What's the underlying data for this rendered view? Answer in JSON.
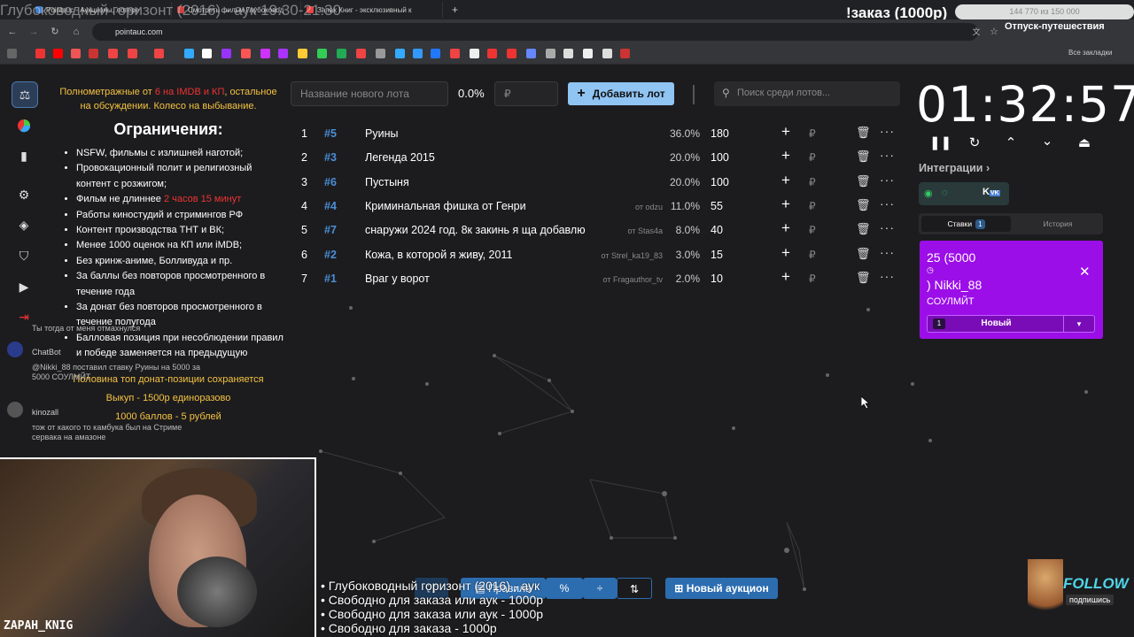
{
  "browser": {
    "tabs": [
      {
        "label": "Pointauc - Аукционы, лотере",
        "color": "#3b7fd6"
      },
      {
        "label": "Смотреть фильм Глубоковод",
        "color": "#c44"
      },
      {
        "label": "Запах Книг - эксклюзивный к",
        "color": "#e44"
      }
    ],
    "url": "pointauc.com",
    "all_bookmarks": "Все закладки"
  },
  "overlay": {
    "stream_title": "Глубоководный горизонт (2016) - аук 19:30-21:30",
    "zakaz": "!заказ (1000р)",
    "counter": "144 770 из 150 000",
    "otpusk": "Отпуск-путешествия",
    "follow": "FOLLOW",
    "podpishis": "подпишись",
    "camname": "ZAPAH_KNIG",
    "bottom_list": [
      "• Глубоководный горизонт (2016) - аук",
      "• Свободно для заказа или аук - 1000р",
      "• Свободно для заказа или аук - 1000р",
      "• Свободно для заказа - 1000р"
    ]
  },
  "rules": {
    "intro_a": "Полнометражные от ",
    "intro_red": "6 на IMDB и КП",
    "intro_b": ", остальное на обсуждении. Колесо на выбывание.",
    "heading": "Ограничения:",
    "items": [
      "NSFW, фильмы с излишней наготой;",
      "Провокационный полит и религиозный контент с розжигом;",
      "Работы киностудий и стримингов РФ",
      "Контент производства ТНТ и ВК;",
      "Менее 1000 оценок на КП или iMDB;",
      "Без кринж-аниме, Болливуда и пр.",
      "За баллы без повторов просмотренного в течение года",
      "За донат без повторов просмотренного в течение полугода",
      "Балловая позиция при несоблюдении правил и победе заменяется на предыдущую"
    ],
    "film_limit_a": "Фильм не длиннее ",
    "film_limit_red": "2 часов 15 минут",
    "footer": [
      "Половина топ донат-позиции сохраняется",
      "Выкуп - 1500р единоразово",
      "1000 баллов - 5 рублей"
    ]
  },
  "chat": [
    {
      "text": "Ты тогда от меня отмахнулся"
    },
    {
      "user": "ChatBot",
      "text": "@Nikki_88 поставил ставку Руины на 5000 за 5000 СОУЛМЙТ"
    },
    {
      "user": "kinozall",
      "text": "тож от какого то камбука был на Стриме сервака на амазоне"
    }
  ],
  "auction": {
    "lot_placeholder": "Название нового лота",
    "total_pct": "0.0%",
    "rub_placeholder": "₽",
    "add_button": "Добавить лот",
    "search_placeholder": "Поиск среди лотов...",
    "rub": "₽",
    "lots": [
      {
        "n": "1",
        "rank": "#5",
        "name": "Руины",
        "from": "",
        "pct": "36.0%",
        "amount": "180"
      },
      {
        "n": "2",
        "rank": "#3",
        "name": "Легенда 2015",
        "from": "",
        "pct": "20.0%",
        "amount": "100"
      },
      {
        "n": "3",
        "rank": "#6",
        "name": "Пустыня",
        "from": "",
        "pct": "20.0%",
        "amount": "100"
      },
      {
        "n": "4",
        "rank": "#4",
        "name": "Криминальная фишка от Генри",
        "from": "от odzu",
        "pct": "11.0%",
        "amount": "55"
      },
      {
        "n": "5",
        "rank": "#7",
        "name": "снаружи 2024 год. 8к закинь я ща добавлю",
        "from": "от Stas4a",
        "pct": "8.0%",
        "amount": "40"
      },
      {
        "n": "6",
        "rank": "#2",
        "name": "Кожа, в которой я живу, 2011",
        "from": "от Strel_ka19_83",
        "pct": "3.0%",
        "amount": "15"
      },
      {
        "n": "7",
        "rank": "#1",
        "name": "Враг у ворот",
        "from": "от Fragauthor_tv",
        "pct": "2.0%",
        "amount": "10"
      }
    ]
  },
  "timer": {
    "value": "01:32:57"
  },
  "integrations": {
    "label": "Интеграции"
  },
  "bids": {
    "tab_bids": "Ставки",
    "tab_bids_count": "1",
    "tab_history": "История",
    "card": {
      "amount": "25 (5000",
      "user": ") Nikki_88",
      "message": "СОУЛМЙТ",
      "slot": "1",
      "select": "Новый"
    }
  },
  "toolbar": {
    "rules": "Правила",
    "percent": "%",
    "new_auction": "Новый аукцион"
  },
  "colors": {
    "accent": "#90c4f3",
    "bid_card": "#9c0ee8",
    "rank": "#4a8fd8",
    "rules_yellow": "#f5c242"
  }
}
